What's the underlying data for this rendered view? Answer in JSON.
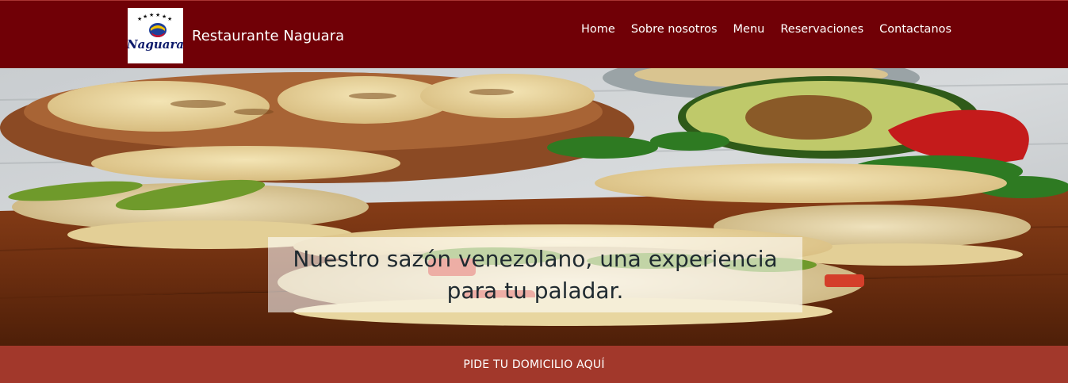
{
  "brand": {
    "logo_text": "Naguara",
    "name": "Restaurante Naguara"
  },
  "nav": {
    "items": [
      {
        "label": "Home"
      },
      {
        "label": "Sobre nosotros"
      },
      {
        "label": "Menu"
      },
      {
        "label": "Reservaciones"
      },
      {
        "label": "Contactanos"
      }
    ]
  },
  "hero": {
    "title": "Nuestro sazón venezolano, una experiencia para tu paladar."
  },
  "delivery": {
    "label": "PIDE TU DOMICILIO AQUÍ"
  },
  "colors": {
    "navbar": "#700006",
    "delivery_bar": "#a2382b"
  }
}
